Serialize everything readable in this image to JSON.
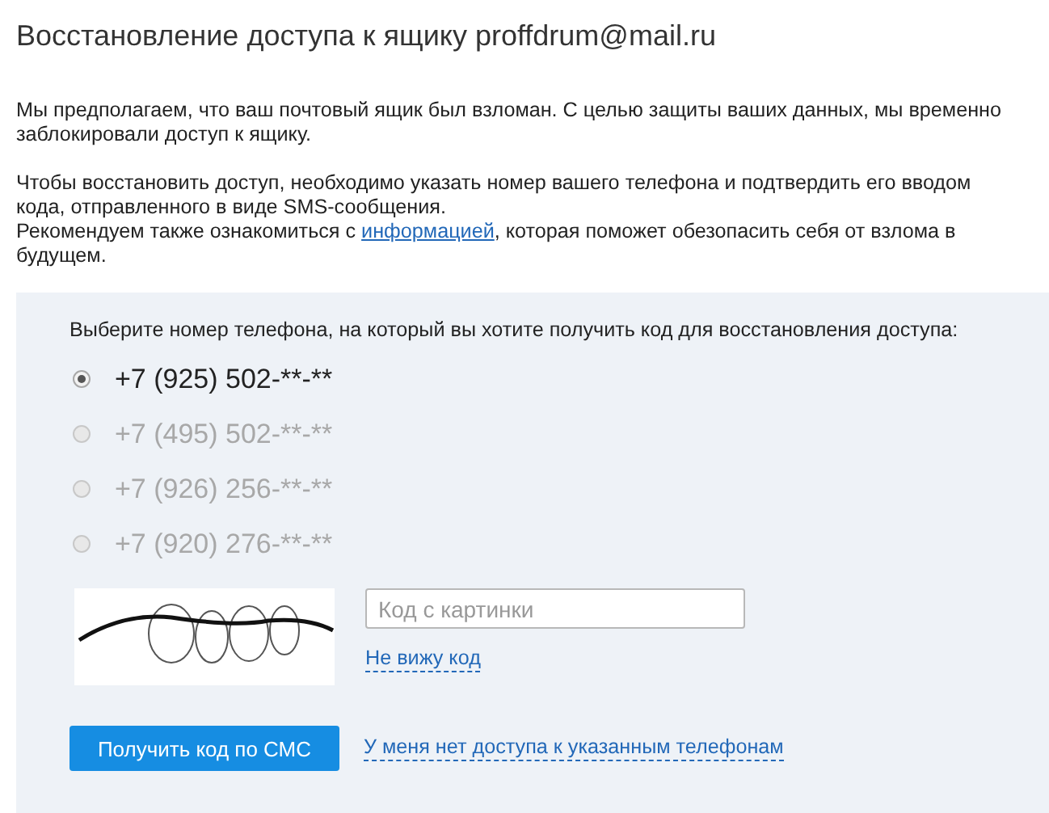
{
  "title": "Восстановление доступа к ящику proffdrum@mail.ru",
  "paragraphs": [
    {
      "text": "Мы предполагаем, что ваш почтовый ящик был взломан. С целью защиты ваших данных, мы временно заблокировали доступ к ящику."
    },
    {
      "text": "Чтобы восстановить доступ, необходимо указать номер вашего телефона и подтвердить его вводом кода, отправленного в виде SMS-сообщения."
    },
    {
      "text": "Рекомендуем также ознакомиться с ",
      "link": "информацией",
      "after": ", которая поможет обезопасить себя от взлома в будущем."
    }
  ],
  "panel": {
    "prompt": "Выберите номер телефона, на который вы хотите получить код для восстановления доступа:",
    "phones": [
      {
        "label": "+7 (925) 502-**-**",
        "selected": true
      },
      {
        "label": "+7 (495) 502-**-**",
        "selected": false
      },
      {
        "label": "+7 (926) 256-**-**",
        "selected": false
      },
      {
        "label": "+7 (920) 276-**-**",
        "selected": false
      }
    ],
    "code_field": {
      "placeholder": "Код с картинки"
    },
    "cant_see_link": "Не вижу код",
    "submit_button": "Получить код по СМС",
    "no_access_link": "У меня нет доступа к указанным телефонам"
  }
}
